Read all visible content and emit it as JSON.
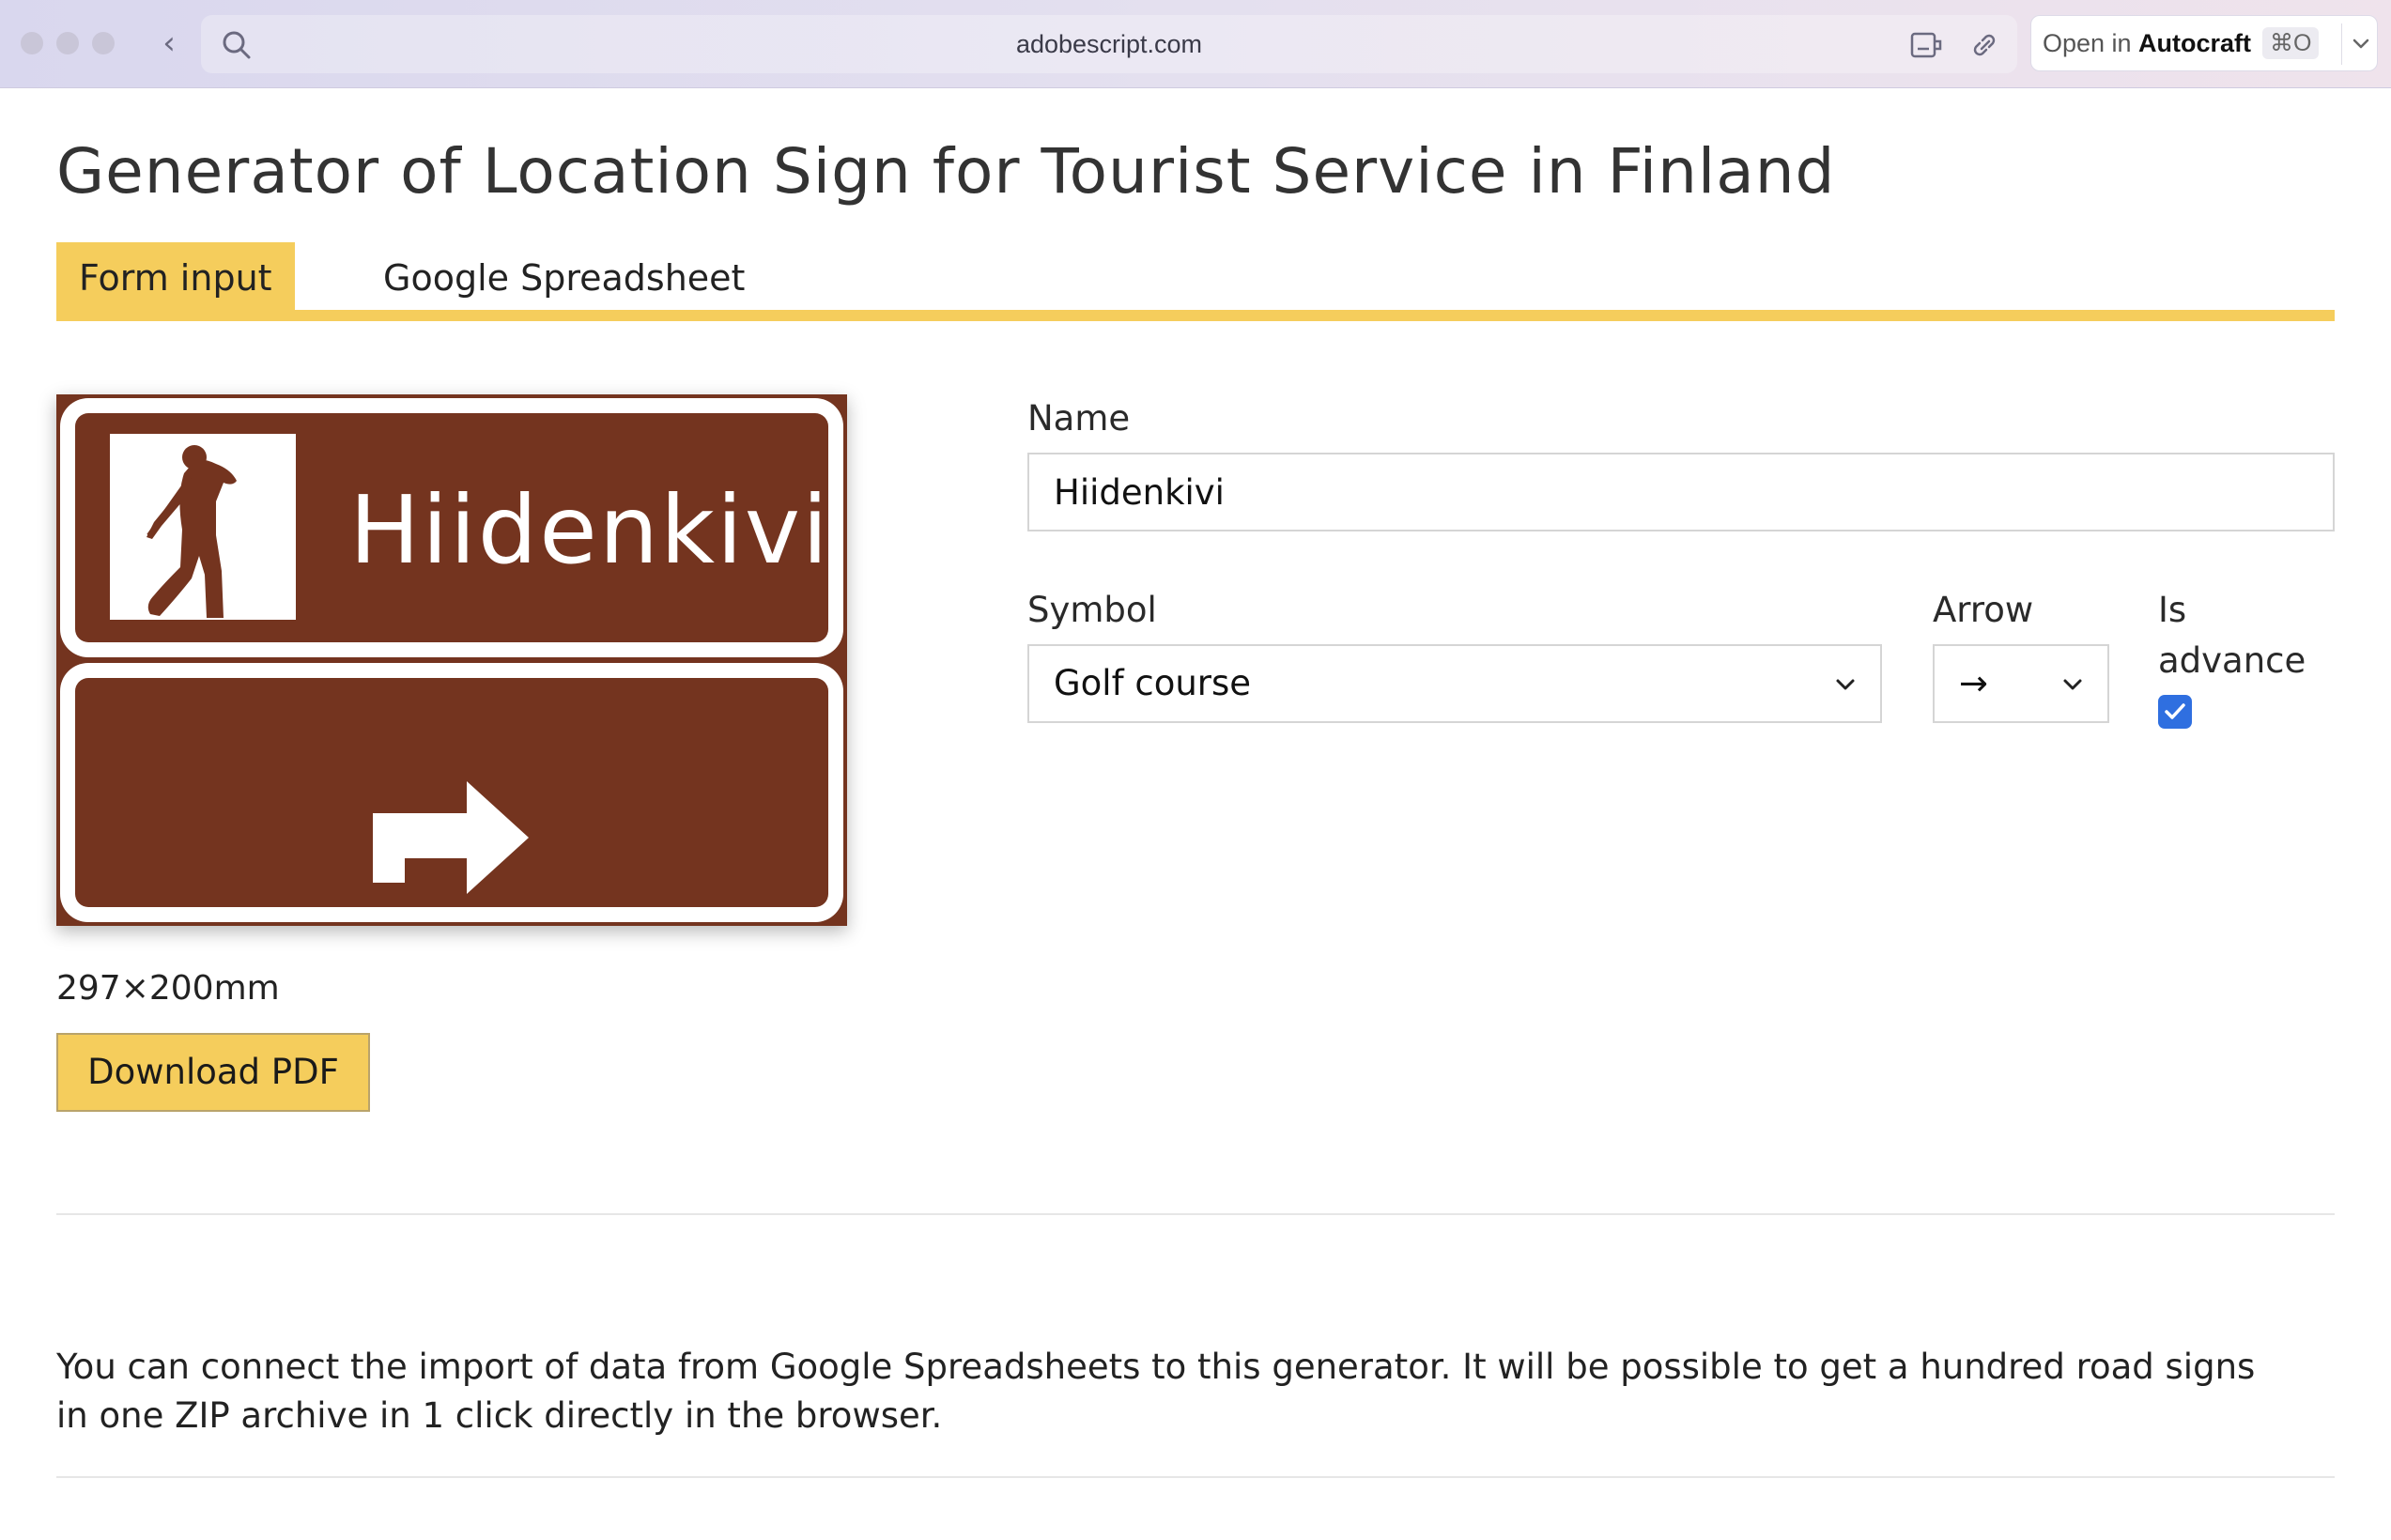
{
  "browser": {
    "url": "adobescript.com",
    "open_in_label": "Open in",
    "open_in_app": "Autocraft",
    "open_in_shortcut": "⌘O"
  },
  "page": {
    "title": "Generator of Location Sign for Tourist Service in Finland",
    "tabs": [
      {
        "label": "Form input",
        "active": true
      },
      {
        "label": "Google Spreadsheet",
        "active": false
      }
    ]
  },
  "sign": {
    "name_text": "Hiidenkivi",
    "symbol_icon": "golfer-icon",
    "arrow_icon": "turn-right-arrow-icon",
    "background_color": "#74341f",
    "size_text": "297×200mm"
  },
  "actions": {
    "download_label": "Download PDF"
  },
  "form": {
    "name_label": "Name",
    "name_value": "Hiidenkivi",
    "symbol_label": "Symbol",
    "symbol_value": "Golf course",
    "arrow_label": "Arrow",
    "arrow_value": "→",
    "advance_label_1": "Is",
    "advance_label_2": "advance",
    "advance_checked": true
  },
  "info": {
    "line1": "You can connect the import of data from Google Spreadsheets to this generator. It will be possible to get a hundred road signs",
    "line2": "in one ZIP archive in 1 click directly in the browser."
  },
  "colors": {
    "accent": "#f5cd5c",
    "sign_brown": "#74341f",
    "checkbox_blue": "#2f6fe0"
  }
}
